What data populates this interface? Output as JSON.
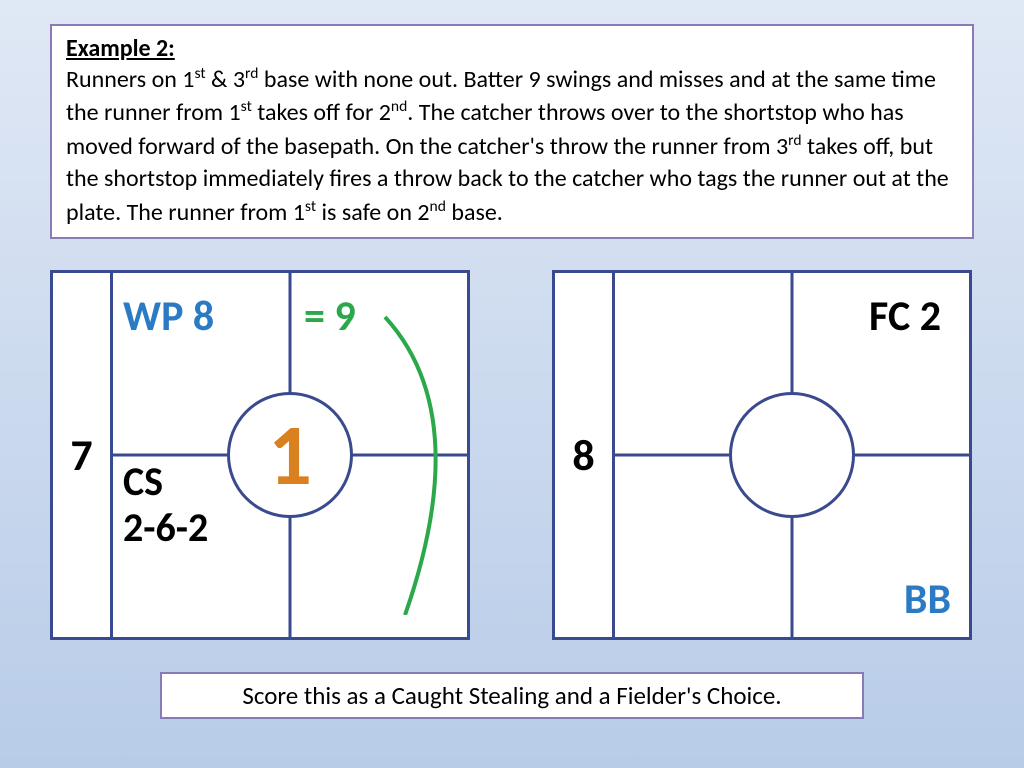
{
  "example": {
    "title": "Example 2:",
    "body_parts": [
      "Runners on 1",
      "st",
      " & 3",
      "rd",
      " base with none out.  Batter 9 swings and misses and at the same time the runner from 1",
      "st",
      " takes off for 2",
      "nd",
      ".  The catcher throws over to the shortstop who has moved forward of the basepath.  On the catcher's throw the runner from 3",
      "rd",
      " takes off, but the shortstop immediately fires a throw back to the catcher who tags the runner out at the plate.  The runner from 1",
      "st",
      " is safe on 2",
      "nd",
      " base."
    ]
  },
  "box1": {
    "side": "7",
    "tl": "WP 8",
    "tr": "= 9",
    "bl_line1": "CS",
    "bl_line2": "2-6-2",
    "center": "1"
  },
  "box2": {
    "side": "8",
    "tr": "FC 2",
    "br": "BB"
  },
  "footer": "Score this as a Caught Stealing and a Fielder's Choice."
}
